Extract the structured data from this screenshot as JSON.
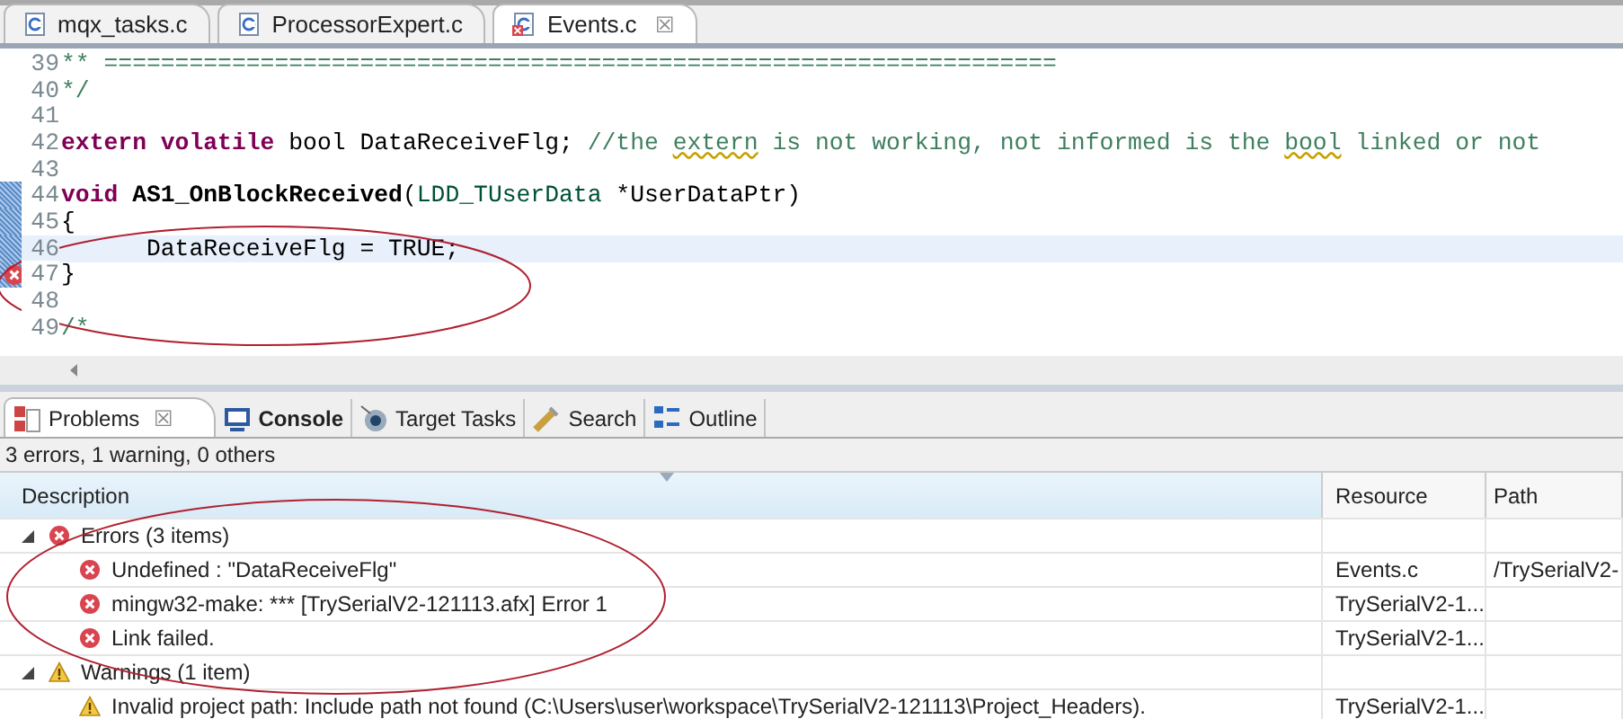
{
  "editor_tabs": [
    {
      "label": "mqx_tasks.c",
      "selected": false,
      "error": false
    },
    {
      "label": "ProcessorExpert.c",
      "selected": false,
      "error": false
    },
    {
      "label": "Events.c",
      "selected": true,
      "error": true,
      "close": "☒"
    }
  ],
  "code_lines": [
    {
      "number": "39",
      "changed": false,
      "current": false,
      "error": false,
      "segments": [
        {
          "kind": "comment",
          "text": "** ==================================================================="
        }
      ]
    },
    {
      "number": "40",
      "changed": false,
      "current": false,
      "error": false,
      "segments": [
        {
          "kind": "comment",
          "text": "*/"
        }
      ]
    },
    {
      "number": "41",
      "changed": false,
      "current": false,
      "error": false
    },
    {
      "number": "42",
      "changed": false,
      "current": false,
      "error": false,
      "segments": [
        {
          "kind": "keyword",
          "text": "extern volatile"
        },
        {
          "kind": "plain",
          "text": " bool DataReceiveFlg; "
        },
        {
          "kind": "comment",
          "text": "//the "
        },
        {
          "kind": "misspelled",
          "text": "extern"
        },
        {
          "kind": "comment",
          "text": " is not working, not informed is the "
        },
        {
          "kind": "misspelled",
          "text": "bool"
        },
        {
          "kind": "comment",
          "text": " linked or not"
        }
      ]
    },
    {
      "number": "43",
      "changed": false,
      "current": false,
      "error": false
    },
    {
      "number": "44",
      "changed": true,
      "current": false,
      "error": false,
      "segments": [
        {
          "kind": "keyword",
          "text": "void "
        },
        {
          "kind": "function",
          "text": "AS1_OnBlockReceived"
        },
        {
          "kind": "plain",
          "text": "("
        },
        {
          "kind": "type",
          "text": "LDD_TUserData"
        },
        {
          "kind": "plain",
          "text": " *UserDataPtr)"
        }
      ]
    },
    {
      "number": "45",
      "changed": true,
      "current": false,
      "error": false,
      "segments": [
        {
          "kind": "plain",
          "text": "{"
        }
      ]
    },
    {
      "number": "46",
      "changed": true,
      "current": true,
      "error": false,
      "segments": [
        {
          "kind": "plain",
          "text": "      DataReceiveFlg = TRUE;"
        }
      ]
    },
    {
      "number": "47",
      "changed": true,
      "current": false,
      "error": true,
      "segments": [
        {
          "kind": "plain",
          "text": "}"
        }
      ]
    },
    {
      "number": "48",
      "changed": false,
      "current": false,
      "error": false
    },
    {
      "number": "49",
      "changed": false,
      "current": false,
      "error": false,
      "segments": [
        {
          "kind": "comment",
          "text": "/*"
        }
      ]
    }
  ],
  "view_tabs": [
    {
      "label": "Problems",
      "selected": true,
      "close": "☒"
    },
    {
      "label": "Console",
      "selected": false
    },
    {
      "label": "Target Tasks",
      "selected": false
    },
    {
      "label": "Search",
      "selected": false
    },
    {
      "label": "Outline",
      "selected": false
    }
  ],
  "summary": "3 errors, 1 warning, 0 others",
  "table": {
    "columns": [
      "Description",
      "Resource",
      "Path"
    ],
    "groups": [
      {
        "label": "Errors (3 items)",
        "kind": "error",
        "expanded": true,
        "children": [
          {
            "description": "Undefined : \"DataReceiveFlg\"",
            "resource": "Events.c",
            "path": "/TrySerialV2-"
          },
          {
            "description": "mingw32-make: *** [TrySerialV2-121113.afx] Error 1",
            "resource": "TrySerialV2-1..."
          },
          {
            "description": "Link failed.",
            "resource": "TrySerialV2-1..."
          }
        ]
      },
      {
        "label": "Warnings (1 item)",
        "kind": "warning",
        "expanded": true,
        "children": [
          {
            "description": "Invalid project path: Include path not found (C:\\Users\\user\\workspace\\TrySerialV2-121113\\Project_Headers).",
            "resource": "TrySerialV2-1..."
          }
        ]
      }
    ]
  }
}
